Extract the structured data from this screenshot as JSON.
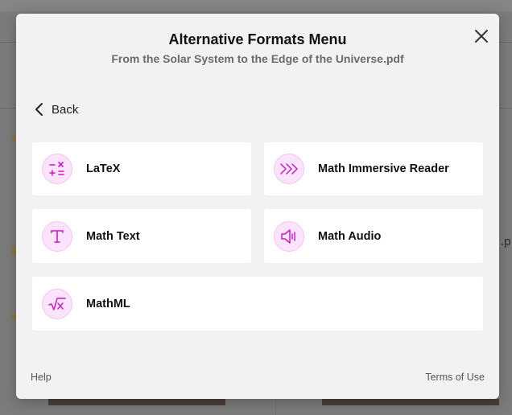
{
  "background": {
    "partial_text": ".p"
  },
  "modal": {
    "title": "Alternative Formats Menu",
    "subtitle": "From the Solar System to the Edge of the Universe.pdf",
    "back_label": "Back",
    "options": [
      {
        "label": "LaTeX",
        "icon": "latex-symbols-icon"
      },
      {
        "label": "Math Immersive Reader",
        "icon": "immersive-reader-icon"
      },
      {
        "label": "Math Text",
        "icon": "text-t-icon"
      },
      {
        "label": "Math Audio",
        "icon": "speaker-icon"
      },
      {
        "label": "MathML",
        "icon": "square-root-icon"
      }
    ],
    "footer": {
      "help": "Help",
      "terms": "Terms of Use"
    }
  },
  "colors": {
    "accent": "#c21fc2",
    "icon_bg": "#fbe3fb",
    "modal_bg": "#f2f2f2",
    "card_bg": "#ffffff"
  }
}
